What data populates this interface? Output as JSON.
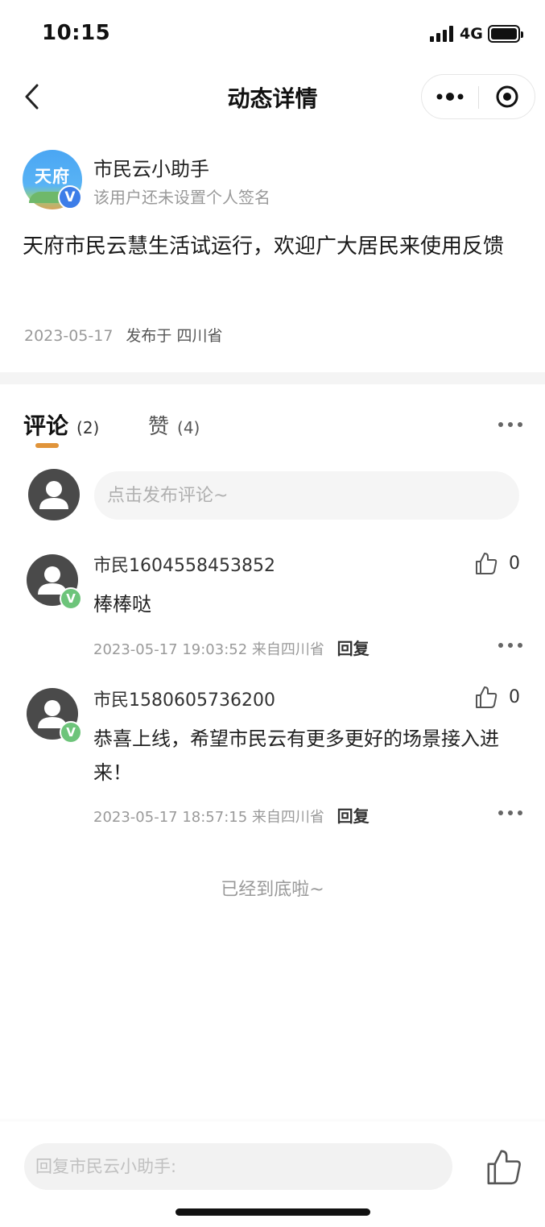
{
  "status_bar": {
    "time": "10:15",
    "network": "4G"
  },
  "nav": {
    "title": "动态详情"
  },
  "post": {
    "author_logo_text": "天府",
    "verified_mark": "V",
    "author_name": "市民云小助手",
    "author_signature": "该用户还未设置个人签名",
    "content": "天府市民云慧生活试运行，欢迎广大居民来使用反馈",
    "date": "2023-05-17",
    "location": "发布于 四川省"
  },
  "tabs": {
    "comments_label": "评论",
    "comments_count": "(2)",
    "likes_label": "赞",
    "likes_count": "(4)"
  },
  "comment_box": {
    "placeholder": "点击发布评论~"
  },
  "comments": [
    {
      "name": "市民1604558453852",
      "text": "棒棒哒",
      "time": "2023-05-17 19:03:52",
      "location": "来自四川省",
      "reply_label": "回复",
      "likes": "0",
      "verified_mark": "V"
    },
    {
      "name": "市民1580605736200",
      "text": "恭喜上线，希望市民云有更多更好的场景接入进来！",
      "time": "2023-05-17 18:57:15",
      "location": "来自四川省",
      "reply_label": "回复",
      "likes": "0",
      "verified_mark": "V"
    }
  ],
  "end_text": "已经到底啦~",
  "bottom": {
    "reply_placeholder": "回复市民云小助手:"
  },
  "icons": {
    "back": "chevron-left-icon",
    "more": "more-dots-icon",
    "close": "target-circle-icon",
    "like": "thumbs-up-icon",
    "avatar": "user-silhouette-icon"
  },
  "colors": {
    "tab_underline": "#e0943a",
    "verified_blue": "#3d7de8",
    "verified_green": "#6dc47a"
  }
}
